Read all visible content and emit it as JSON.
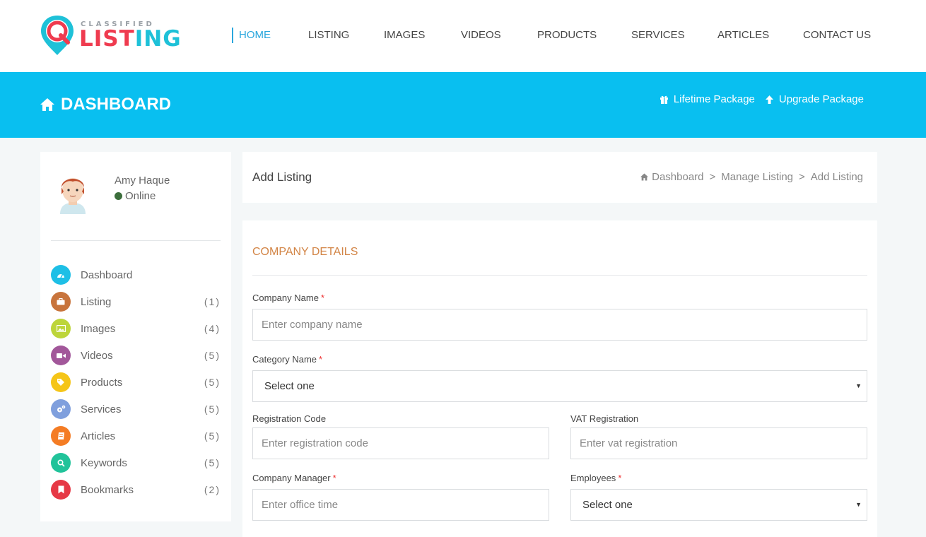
{
  "logo": {
    "small": "CLASSIFIED",
    "big_part1": "LIST",
    "big_part2": "ING"
  },
  "nav": [
    "HOME",
    "LISTING",
    "IMAGES",
    "VIDEOS",
    "PRODUCTS",
    "SERVICES",
    "ARTICLES",
    "CONTACT US"
  ],
  "banner": {
    "title": "DASHBOARD",
    "lifetime": "Lifetime Package",
    "upgrade": "Upgrade Package"
  },
  "user": {
    "name": "Amy Haque",
    "status": "Online"
  },
  "menu": [
    {
      "label": "Dashboard",
      "count": "",
      "color": "#1ebfe6",
      "icon": "dashboard-icon"
    },
    {
      "label": "Listing",
      "count": "(1)",
      "color": "#c8743c",
      "icon": "briefcase-icon"
    },
    {
      "label": "Images",
      "count": "(4)",
      "color": "#bdd53a",
      "icon": "image-icon"
    },
    {
      "label": "Videos",
      "count": "(5)",
      "color": "#a2579a",
      "icon": "video-icon"
    },
    {
      "label": "Products",
      "count": "(5)",
      "color": "#f5c518",
      "icon": "tag-icon"
    },
    {
      "label": "Services",
      "count": "(5)",
      "color": "#7f9fdd",
      "icon": "cogs-icon"
    },
    {
      "label": "Articles",
      "count": "(5)",
      "color": "#f47c24",
      "icon": "book-icon"
    },
    {
      "label": "Keywords",
      "count": "(5)",
      "color": "#21c39a",
      "icon": "search-icon"
    },
    {
      "label": "Bookmarks",
      "count": "(2)",
      "color": "#e63946",
      "icon": "bookmark-icon"
    }
  ],
  "page": {
    "title": "Add Listing"
  },
  "breadcrumb": {
    "home": "Dashboard",
    "middle": "Manage Listing",
    "current": "Add Listing",
    "sep": ">"
  },
  "form": {
    "section": "COMPANY DETAILS",
    "company_name": {
      "label": "Company Name",
      "placeholder": "Enter company name"
    },
    "category": {
      "label": "Category Name",
      "value": "Select one"
    },
    "reg_code": {
      "label": "Registration Code",
      "placeholder": "Enter registration code"
    },
    "vat": {
      "label": "VAT Registration",
      "placeholder": "Enter vat registration"
    },
    "manager": {
      "label": "Company Manager",
      "placeholder": "Enter office time"
    },
    "employees": {
      "label": "Employees",
      "value": "Select one"
    },
    "required_mark": "*"
  },
  "colors": {
    "accent": "#09bff0",
    "nav_active": "#2aa7dd",
    "section": "#d28445",
    "online": "#3c6e3c"
  }
}
